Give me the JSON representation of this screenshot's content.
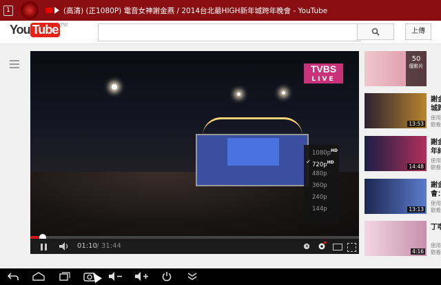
{
  "window": {
    "tab_badge": "1",
    "title": "(高清) (正1080P) 電音女神謝金燕 / 2014台北最HIGH新年城跨年晚會 - YouTube"
  },
  "header": {
    "logo_you": "You",
    "logo_tube": "Tube",
    "logo_region": "TW",
    "search_placeholder": "",
    "search_icon": "🔍",
    "upload_label": "上傳"
  },
  "player": {
    "channel_logo": "TVBS",
    "live_label": "LIVE",
    "time_current": "01:10",
    "time_separator": "/",
    "time_total": "31:44",
    "progress": 0.037,
    "quality_options": [
      {
        "label": "1080p",
        "badge": "HD",
        "selected": false
      },
      {
        "label": "720p",
        "badge": "HD",
        "selected": true
      },
      {
        "label": "480p",
        "badge": "",
        "selected": false
      },
      {
        "label": "360p",
        "badge": "",
        "selected": false
      },
      {
        "label": "240p",
        "badge": "",
        "selected": false
      },
      {
        "label": "144p",
        "badge": "",
        "selected": false
      }
    ],
    "check_glyph": "✓"
  },
  "sidebar": {
    "items": [
      {
        "title": "",
        "meta": "",
        "duration": "",
        "badge_count": "50",
        "badge_label": "個影片"
      },
      {
        "title": "謝金城跨",
        "meta": "使用觀看",
        "duration": "13:53"
      },
      {
        "title": "謝金年終",
        "meta": "使用觀看",
        "duration": "14:48"
      },
      {
        "title": "謝金會：",
        "meta": "使用觀看",
        "duration": "13:13"
      },
      {
        "title": "丁噹",
        "meta": "使用觀看",
        "duration": "4:16"
      }
    ]
  },
  "below_title": " ",
  "system_bar": {
    "icons": [
      "back-icon",
      "home-icon",
      "recent-apps-icon",
      "screenshot-icon",
      "volume-down-icon",
      "volume-up-icon",
      "power-icon",
      "menu-icon"
    ]
  }
}
